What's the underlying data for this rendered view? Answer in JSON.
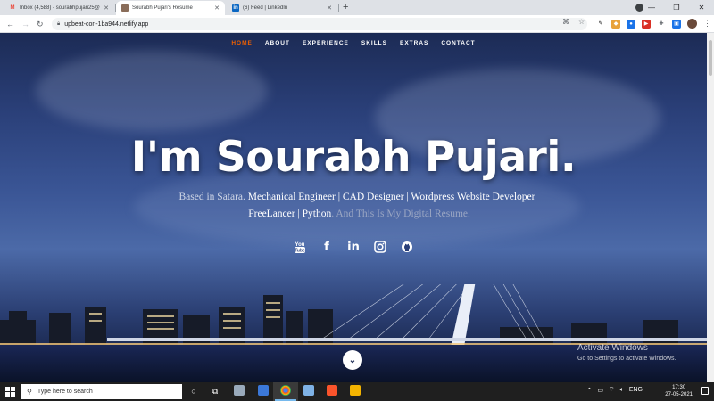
{
  "browser": {
    "tabs": [
      {
        "title": "Inbox (4,588) - sourabhpujari25@",
        "favicon": "gmail-icon",
        "favicon_color": "#ea4335",
        "favicon_glyph": "M"
      },
      {
        "title": "Sourabh Pujari's Resume",
        "favicon": "person-icon",
        "favicon_color": "#8a6d5a",
        "favicon_glyph": ""
      },
      {
        "title": "(6) Feed | LinkedIn",
        "favicon": "linkedin-icon",
        "favicon_color": "#0a66c2",
        "favicon_glyph": "in"
      }
    ],
    "url": "upbeat-cori-1ba944.netlify.app"
  },
  "site": {
    "nav": [
      "HOME",
      "ABOUT",
      "EXPERIENCE",
      "SKILLS",
      "EXTRAS",
      "CONTACT"
    ],
    "active_nav_color": "#f06000",
    "hero_title": "I'm Sourabh Pujari.",
    "hero_intro": "Based in Satara.",
    "hero_roles": "Mechanical Engineer | CAD Designer | Wordpress Website Developer | FreeLancer | Python",
    "hero_outro": ". And This Is My Digital Resume.",
    "social": [
      "youtube-icon",
      "facebook-icon",
      "linkedin-icon",
      "instagram-icon",
      "github-icon"
    ],
    "social_glyphs": [
      "You\nTube",
      "f",
      "in",
      "◎",
      "●"
    ]
  },
  "watermark": {
    "line1": "Activate Windows",
    "line2": "Go to Settings to activate Windows."
  },
  "taskbar": {
    "search_placeholder": "Type here to search",
    "lang": "ENG",
    "time": "17:30",
    "date": "27-05-2021"
  }
}
